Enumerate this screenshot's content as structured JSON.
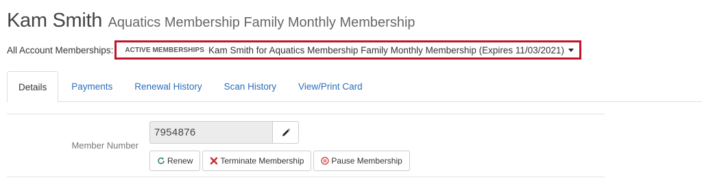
{
  "header": {
    "member_name": "Kam Smith",
    "membership_title": "Aquatics Membership Family Monthly Membership"
  },
  "account": {
    "label": "All Account Memberships:",
    "badge": "ACTIVE MEMBERSHIPS",
    "selected": "Kam Smith for Aquatics Membership Family Monthly Membership (Expires 11/03/2021)"
  },
  "tabs": [
    {
      "label": "Details",
      "active": true
    },
    {
      "label": "Payments"
    },
    {
      "label": "Renewal History"
    },
    {
      "label": "Scan History"
    },
    {
      "label": "View/Print Card"
    }
  ],
  "details": {
    "member_number_label": "Member Number",
    "member_number_value": "7954876"
  },
  "actions": {
    "renew": "Renew",
    "terminate": "Terminate Membership",
    "pause": "Pause Membership"
  },
  "icons": {
    "edit": "pencil-icon",
    "renew": "refresh-icon",
    "terminate": "x-icon",
    "pause": "pause-circle-icon"
  },
  "colors": {
    "highlight_border": "#c0142b",
    "link": "#2a6ebb",
    "renew_icon": "#2e8b57",
    "terminate_icon": "#c9302c",
    "pause_icon": "#c9302c"
  }
}
